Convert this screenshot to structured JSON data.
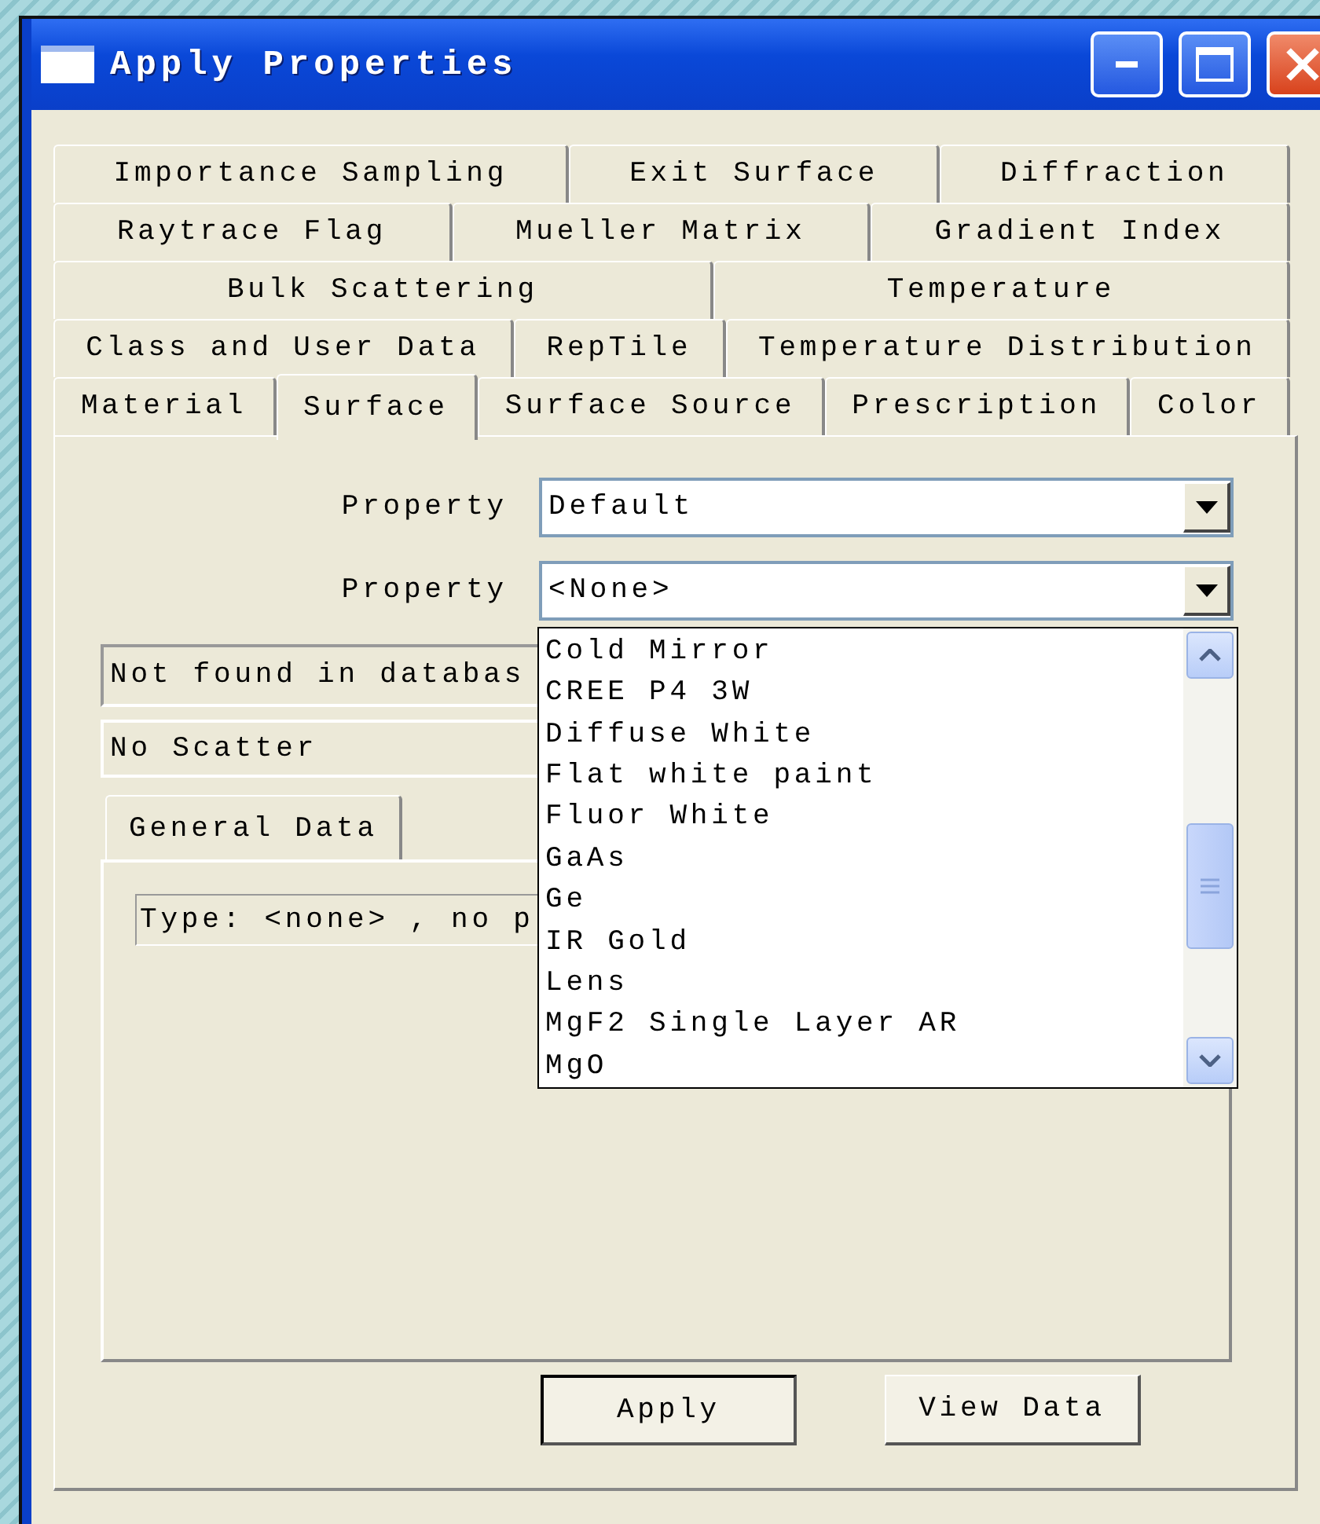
{
  "window": {
    "title": "Apply Properties"
  },
  "tab_rows": [
    [
      {
        "label": "Importance Sampling",
        "selected": false
      },
      {
        "label": "Exit Surface",
        "selected": false
      },
      {
        "label": "Diffraction",
        "selected": false
      }
    ],
    [
      {
        "label": "Raytrace Flag",
        "selected": false
      },
      {
        "label": "Mueller Matrix",
        "selected": false
      },
      {
        "label": "Gradient Index",
        "selected": false
      }
    ],
    [
      {
        "label": "Bulk Scattering",
        "selected": false
      },
      {
        "label": "Temperature",
        "selected": false
      }
    ],
    [
      {
        "label": "Class and User Data",
        "selected": false
      },
      {
        "label": "RepTile",
        "selected": false
      },
      {
        "label": "Temperature Distribution",
        "selected": false
      }
    ],
    [
      {
        "label": "Material",
        "selected": false
      },
      {
        "label": "Surface",
        "selected": true
      },
      {
        "label": "Surface Source",
        "selected": false
      },
      {
        "label": "Prescription",
        "selected": false
      },
      {
        "label": "Color",
        "selected": false
      }
    ]
  ],
  "properties": [
    {
      "label": "Property",
      "value": "Default"
    },
    {
      "label": "Property",
      "value": "<None>",
      "open_list": [
        "Cold Mirror",
        "CREE P4 3W",
        "Diffuse White",
        "Flat white paint",
        "Fluor White",
        "GaAs",
        "Ge",
        "IR Gold",
        "Lens",
        "MgF2 Single Layer AR",
        "MgO"
      ]
    }
  ],
  "status_fields": [
    "Not found in databas",
    "No Scatter"
  ],
  "inner_tabs": [
    {
      "label": "General Data",
      "selected": true
    }
  ],
  "info_field": "Type: <none> , no p",
  "buttons": [
    {
      "label": "Apply",
      "default": true
    },
    {
      "label": "View Data",
      "default": false
    }
  ]
}
